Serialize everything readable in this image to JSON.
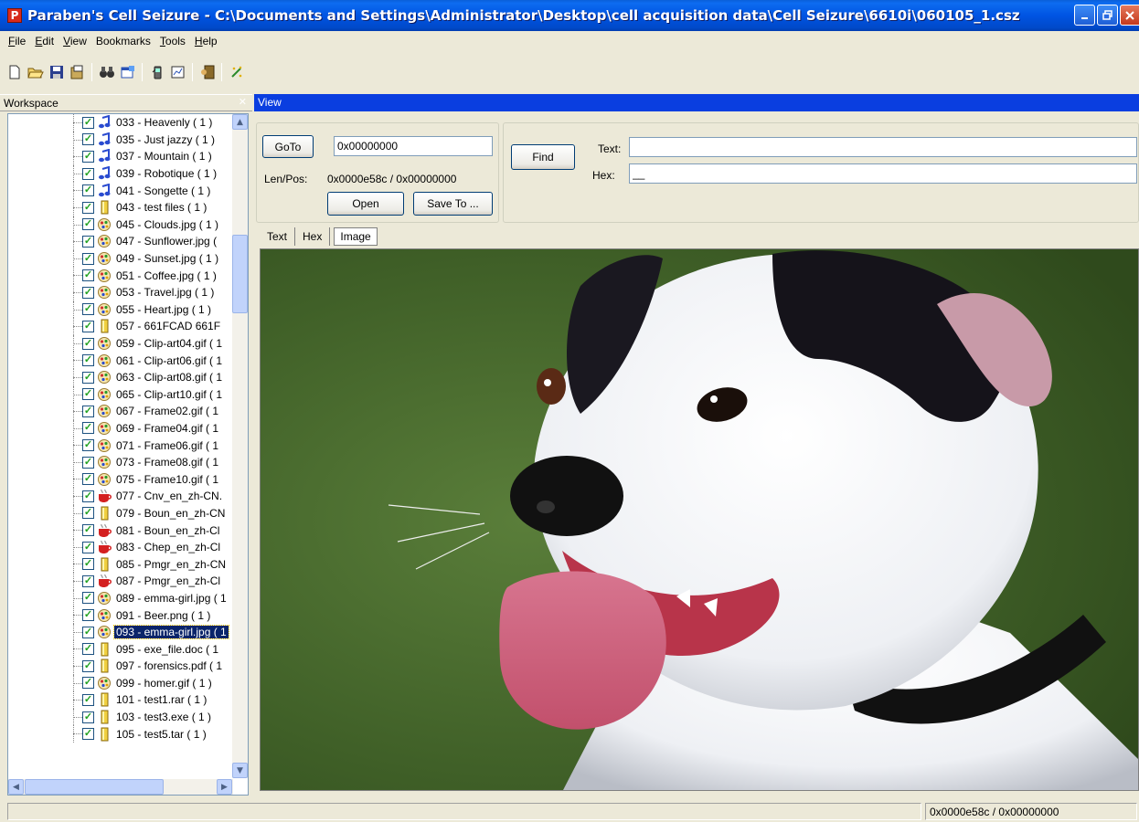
{
  "window": {
    "title": "Paraben's Cell Seizure - C:\\Documents and Settings\\Administrator\\Desktop\\cell acquisition data\\Cell Seizure\\6610i\\060105_1.csz",
    "app_icon_letter": "P"
  },
  "menu": [
    {
      "label": "File",
      "u": "F",
      "rest": "ile"
    },
    {
      "label": "Edit",
      "u": "E",
      "rest": "dit"
    },
    {
      "label": "View",
      "u": "V",
      "rest": "iew"
    },
    {
      "label": "Bookmarks",
      "u": "",
      "rest": "Bookmarks"
    },
    {
      "label": "Tools",
      "u": "T",
      "rest": "ools"
    },
    {
      "label": "Help",
      "u": "H",
      "rest": "elp"
    }
  ],
  "panes": {
    "workspace_label": "Workspace",
    "view_label": "View"
  },
  "tree_items": [
    {
      "label": "033 - Heavenly ( 1 )",
      "icon": "music-note-icon"
    },
    {
      "label": "035 - Just jazzy ( 1 )",
      "icon": "music-note-icon"
    },
    {
      "label": "037 - Mountain ( 1 )",
      "icon": "music-note-icon"
    },
    {
      "label": "039 - Robotique ( 1 )",
      "icon": "music-note-icon"
    },
    {
      "label": "041 - Songette ( 1 )",
      "icon": "music-note-icon"
    },
    {
      "label": "043 - test files ( 1 )",
      "icon": "file-icon"
    },
    {
      "label": "045 - Clouds.jpg ( 1 )",
      "icon": "image-icon"
    },
    {
      "label": "047 - Sunflower.jpg (",
      "icon": "image-icon"
    },
    {
      "label": "049 - Sunset.jpg ( 1 )",
      "icon": "image-icon"
    },
    {
      "label": "051 - Coffee.jpg ( 1 )",
      "icon": "image-icon"
    },
    {
      "label": "053 - Travel.jpg ( 1 )",
      "icon": "image-icon"
    },
    {
      "label": "055 - Heart.jpg ( 1 )",
      "icon": "image-icon"
    },
    {
      "label": "057 - 661FCAD 661F",
      "icon": "file-icon"
    },
    {
      "label": "059 - Clip-art04.gif ( 1",
      "icon": "image-icon"
    },
    {
      "label": "061 - Clip-art06.gif ( 1",
      "icon": "image-icon"
    },
    {
      "label": "063 - Clip-art08.gif ( 1",
      "icon": "image-icon"
    },
    {
      "label": "065 - Clip-art10.gif ( 1",
      "icon": "image-icon"
    },
    {
      "label": "067 - Frame02.gif ( 1",
      "icon": "image-icon"
    },
    {
      "label": "069 - Frame04.gif ( 1",
      "icon": "image-icon"
    },
    {
      "label": "071 - Frame06.gif ( 1",
      "icon": "image-icon"
    },
    {
      "label": "073 - Frame08.gif ( 1",
      "icon": "image-icon"
    },
    {
      "label": "075 - Frame10.gif ( 1",
      "icon": "image-icon"
    },
    {
      "label": "077 - Cnv_en_zh-CN.",
      "icon": "java-cup-icon"
    },
    {
      "label": "079 - Boun_en_zh-CN",
      "icon": "file-icon"
    },
    {
      "label": "081 - Boun_en_zh-Cl",
      "icon": "java-cup-icon"
    },
    {
      "label": "083 - Chep_en_zh-Cl",
      "icon": "java-cup-icon"
    },
    {
      "label": "085 - Pmgr_en_zh-CN",
      "icon": "file-icon"
    },
    {
      "label": "087 - Pmgr_en_zh-Cl",
      "icon": "java-cup-icon"
    },
    {
      "label": "089 - emma-girl.jpg ( 1",
      "icon": "image-icon"
    },
    {
      "label": "091 - Beer.png ( 1 )",
      "icon": "image-icon"
    },
    {
      "label": "093 - emma-girl.jpg ( 1",
      "icon": "image-icon",
      "selected": true
    },
    {
      "label": "095 - exe_file.doc ( 1",
      "icon": "file-icon"
    },
    {
      "label": "097 - forensics.pdf ( 1",
      "icon": "file-icon"
    },
    {
      "label": "099 - homer.gif ( 1 )",
      "icon": "image-icon"
    },
    {
      "label": "101 - test1.rar ( 1 )",
      "icon": "file-icon"
    },
    {
      "label": "103 - test3.exe ( 1 )",
      "icon": "file-icon"
    },
    {
      "label": "105 - test5.tar ( 1 )",
      "icon": "file-icon"
    }
  ],
  "view": {
    "goto_label": "GoTo",
    "goto_value": "0x00000000",
    "lenpos_label": "Len/Pos:",
    "lenpos_value": "0x0000e58c / 0x00000000",
    "open_label": "Open",
    "saveto_label": "Save To ...",
    "find_label": "Find",
    "text_label": "Text:",
    "text_value": "",
    "hex_label": "Hex:",
    "hex_value": "__",
    "tabs": [
      "Text",
      "Hex",
      "Image"
    ],
    "active_tab": "Image"
  },
  "status": {
    "left": "",
    "right": "0x0000e58c / 0x00000000"
  },
  "colors": {
    "title_bar": "#0054e3",
    "view_header": "#0a3ee0",
    "window_bg": "#ece9d8",
    "selection": "#0a246a"
  }
}
